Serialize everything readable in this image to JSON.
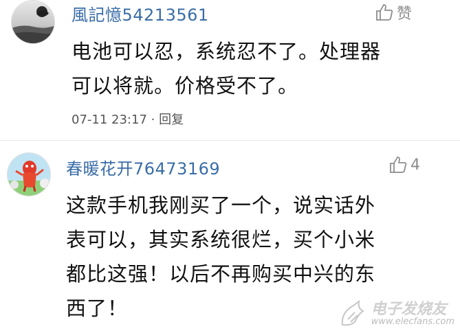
{
  "comments": [
    {
      "username": "風記憶54213561",
      "like_label": "赞",
      "content": "电池可以忍，系统忍不了。处理器\n可以将就。价格受不了。",
      "timestamp": "07-11 23:17",
      "separator": "·",
      "reply_label": "回复"
    },
    {
      "username": "春暖花开76473169",
      "like_count": "4",
      "content": "这款手机我刚买了一个，说实话外\n表可以，其实系统很烂，买个小米\n都比这强！以后不再购买中兴的东\n西了！"
    }
  ],
  "watermark": {
    "logo_text": "电子发烧友",
    "url": "www.elecfans.com"
  },
  "colors": {
    "username": "#3a6da8",
    "meta": "#555555",
    "like": "#8c8c8c"
  }
}
